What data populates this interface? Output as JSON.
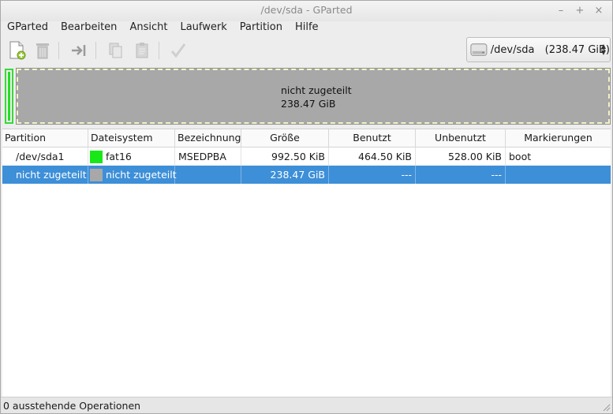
{
  "window": {
    "title": "/dev/sda - GParted"
  },
  "menu": [
    "GParted",
    "Bearbeiten",
    "Ansicht",
    "Laufwerk",
    "Partition",
    "Hilfe"
  ],
  "device": {
    "name": "/dev/sda",
    "size": "(238.47 GiB)"
  },
  "diskmap": {
    "label": "nicht zugeteilt",
    "size": "238.47 GiB"
  },
  "table": {
    "headers": [
      "Partition",
      "Dateisystem",
      "Bezeichnung",
      "Größe",
      "Benutzt",
      "Unbenutzt",
      "Markierungen"
    ],
    "rows": [
      {
        "partition": "/dev/sda1",
        "fs": "fat16",
        "fs_color": "#18e818",
        "label": "MSEDPBA",
        "size": "992.50 KiB",
        "used": "464.50 KiB",
        "unused": "528.00 KiB",
        "flags": "boot"
      },
      {
        "partition": "nicht zugeteilt",
        "fs": "nicht zugeteilt",
        "fs_color": "#a8a8a8",
        "label": "",
        "size": "238.47 GiB",
        "used": "---",
        "unused": "---",
        "flags": ""
      }
    ]
  },
  "status": {
    "text": "0 ausstehende Operationen"
  },
  "colors": {
    "selection": "#3d8fd8",
    "used": "#18e818",
    "unallocated": "#a8a8a8"
  }
}
